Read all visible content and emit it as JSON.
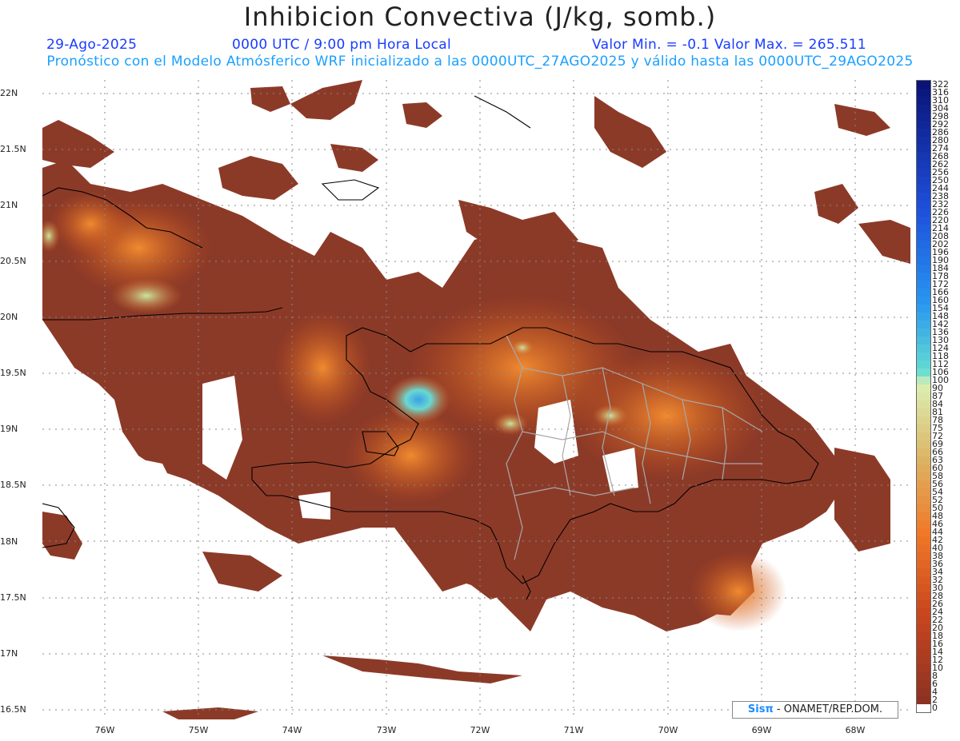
{
  "header": {
    "title": "Inhibicion Convectiva (J/kg, somb.)",
    "date": "29-Ago-2025",
    "time": "0000 UTC / 9:00 pm Hora Local",
    "minmax": "Valor Min. = -0.1  Valor Max. = 265.511",
    "description": "Pronóstico con el Modelo Atmósferico WRF inicializado a las 0000UTC_27AGO2025 y válido hasta las  0000UTC_29AGO2025"
  },
  "axes": {
    "lat_labels": [
      "22N",
      "21.5N",
      "21N",
      "20.5N",
      "20N",
      "19.5N",
      "19N",
      "18.5N",
      "18N",
      "17.5N",
      "17N",
      "16.5N"
    ],
    "lon_labels": [
      "76W",
      "75W",
      "74W",
      "73W",
      "72W",
      "71W",
      "70W",
      "69W",
      "68W"
    ]
  },
  "colorbar": {
    "labels": [
      "322",
      "316",
      "310",
      "304",
      "298",
      "292",
      "286",
      "280",
      "274",
      "268",
      "262",
      "256",
      "250",
      "244",
      "238",
      "232",
      "226",
      "220",
      "214",
      "208",
      "202",
      "196",
      "190",
      "184",
      "178",
      "172",
      "166",
      "160",
      "154",
      "148",
      "142",
      "136",
      "130",
      "124",
      "118",
      "112",
      "106",
      "100",
      "90",
      "87",
      "84",
      "81",
      "78",
      "75",
      "72",
      "69",
      "66",
      "63",
      "60",
      "58",
      "56",
      "54",
      "52",
      "50",
      "48",
      "46",
      "44",
      "42",
      "40",
      "38",
      "36",
      "34",
      "32",
      "30",
      "28",
      "26",
      "24",
      "22",
      "20",
      "18",
      "16",
      "14",
      "12",
      "10",
      "8",
      "6",
      "4",
      "2",
      "0"
    ]
  },
  "credit": {
    "logo": "Sisπ",
    "text": " - ONAMET/REP.DOM."
  },
  "colors": {
    "title": "#222222",
    "subtitle": "#1a3cff",
    "description": "#1aa0ff",
    "land_fill": "#8c3a28",
    "high_cin": "#e85a10"
  }
}
